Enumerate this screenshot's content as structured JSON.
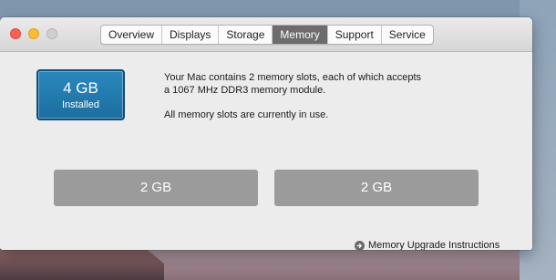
{
  "window": {
    "tabs": [
      {
        "label": "Overview",
        "active": false
      },
      {
        "label": "Displays",
        "active": false
      },
      {
        "label": "Storage",
        "active": false
      },
      {
        "label": "Memory",
        "active": true
      },
      {
        "label": "Support",
        "active": false
      },
      {
        "label": "Service",
        "active": false
      }
    ]
  },
  "memory": {
    "installed_amount": "4 GB",
    "installed_label": "Installed",
    "description_line1": "Your Mac contains 2 memory slots, each of which accepts",
    "description_line2": "a 1067 MHz DDR3 memory module.",
    "slot_status": "All memory slots are currently in use.",
    "slots": [
      {
        "size": "2 GB"
      },
      {
        "size": "2 GB"
      }
    ],
    "upgrade_link": "Memory Upgrade Instructions"
  },
  "colors": {
    "active_tab": "#6c6c6c",
    "installed_box": "#1f77ab",
    "slot_fill": "#9b9b9b",
    "close": "#fc5f57",
    "minimize": "#fdbc2e",
    "zoom_disabled": "#d0d0d0"
  },
  "icons": {
    "upgrade_link_icon": "arrow-circle-right-icon"
  }
}
